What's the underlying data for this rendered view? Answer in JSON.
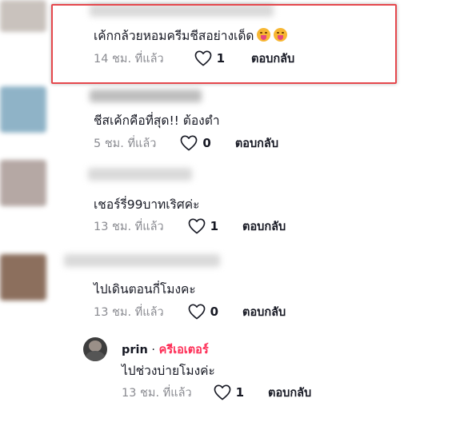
{
  "comments": [
    {
      "text": "เค้กกล้วยหอมครีมชีสอย่างเด็ด",
      "emoji": [
        "face-savoring-food-emoji",
        "face-savoring-food-emoji"
      ],
      "time": "14 ชม. ที่แล้ว",
      "likes": "1",
      "reply": "ตอบกลับ",
      "highlighted": true
    },
    {
      "text": "ชีสเค้กคือที่สุด!! ต้องตำ",
      "time": "5 ชม. ที่แล้ว",
      "likes": "0",
      "reply": "ตอบกลับ"
    },
    {
      "text": "เชอร์รี่99บาทเริศค่ะ",
      "time": "13 ชม. ที่แล้ว",
      "likes": "1",
      "reply": "ตอบกลับ"
    },
    {
      "text": "ไปเดินตอนกี่โมงคะ",
      "time": "13 ชม. ที่แล้ว",
      "likes": "0",
      "reply": "ตอบกลับ"
    }
  ],
  "reply_comment": {
    "username": "prin",
    "separator": " · ",
    "badge": "ครีเอเตอร์",
    "text": "ไปช่วงบ่ายโมงค่ะ",
    "time": "13 ชม. ที่แล้ว",
    "likes": "1",
    "reply": "ตอบกลับ"
  },
  "colors": {
    "highlight_border": "#e5484d",
    "creator_badge": "#fe2c55",
    "meta_text": "#8a8b91"
  }
}
